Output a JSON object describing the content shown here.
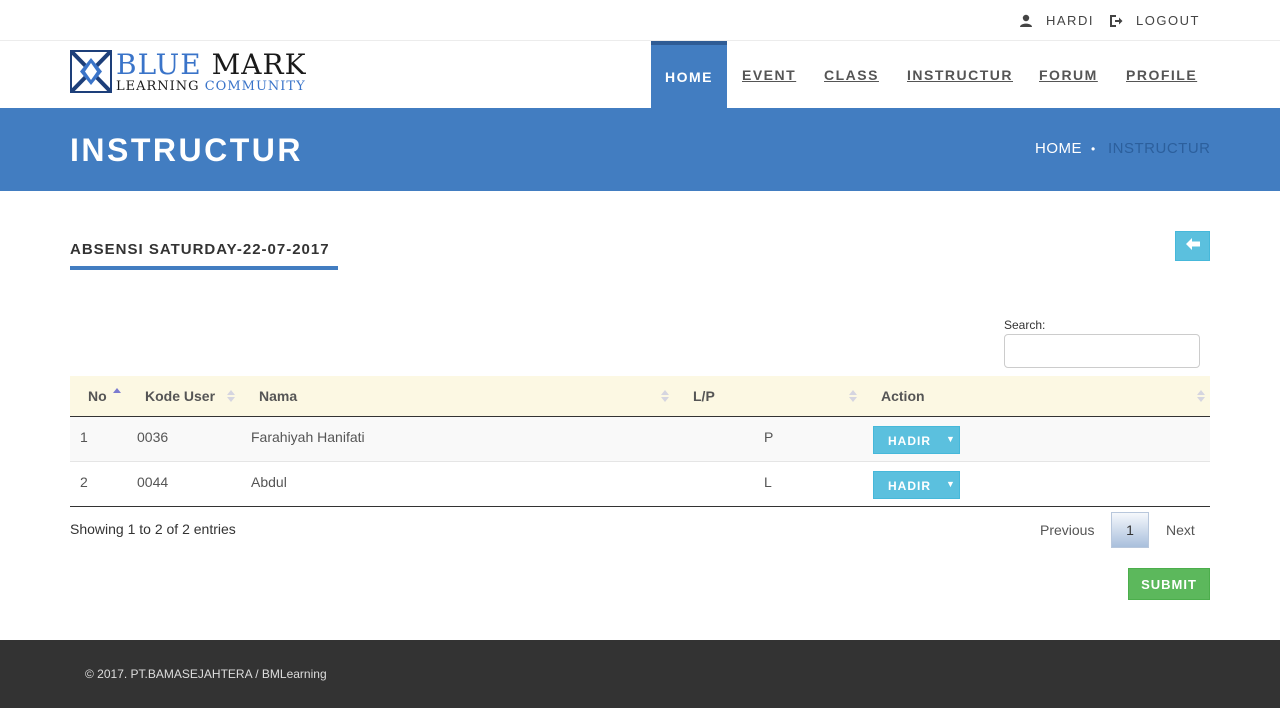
{
  "topbar": {
    "user_label": "HARDI",
    "logout_label": "LOGOUT"
  },
  "logo": {
    "word1": "BLUE",
    "word2": "MARK",
    "word3": "LEARNING",
    "word4": "COMMUNITY"
  },
  "nav": {
    "items": [
      {
        "label": "HOME",
        "active": true
      },
      {
        "label": "EVENT"
      },
      {
        "label": "CLASS"
      },
      {
        "label": "INSTRUCTUR"
      },
      {
        "label": "FORUM"
      },
      {
        "label": "PROFILE"
      }
    ]
  },
  "page": {
    "title": "INSTRUCTUR",
    "breadcrumb": [
      "HOME",
      "•",
      "INSTRUCTUR"
    ]
  },
  "section": {
    "title": "ABSENSI SATURDAY-22-07-2017"
  },
  "search": {
    "label": "Search:",
    "value": ""
  },
  "table": {
    "columns": [
      "No",
      "Kode User",
      "Nama",
      "L/P",
      "Action"
    ],
    "rows": [
      {
        "no": "1",
        "kode": "0036",
        "nama": "Farahiyah Hanifati",
        "lp": "P",
        "action": "HADIR"
      },
      {
        "no": "2",
        "kode": "0044",
        "nama": "Abdul",
        "lp": "L",
        "action": "HADIR"
      }
    ],
    "caret": "▼"
  },
  "pagination": {
    "info": "Showing 1 to 2 of 2 entries",
    "previous": "Previous",
    "current": "1",
    "next": "Next"
  },
  "actions": {
    "submit": "SUBMIT"
  },
  "footer": {
    "text": "© 2017. PT.BAMASEJAHTERA / BMLearning"
  },
  "colors": {
    "primary": "#427dc1",
    "info": "#5bc0de",
    "success": "#5cb85c",
    "footer": "#333333",
    "table_header": "#fcf8e3"
  },
  "icons": {
    "user": "user-icon",
    "logout": "logout-icon",
    "back": "arrow-left-icon"
  }
}
